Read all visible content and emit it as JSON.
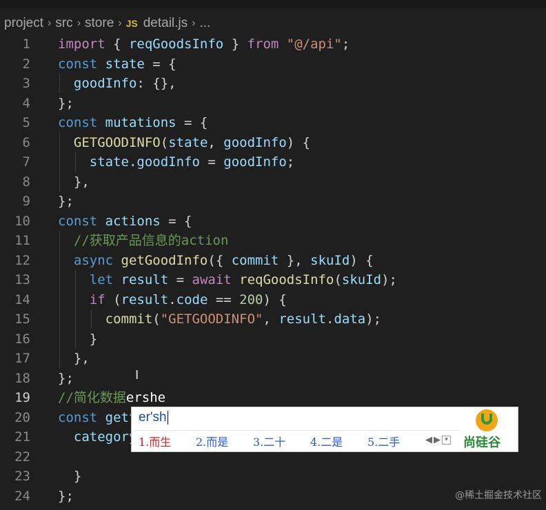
{
  "breadcrumb": {
    "items": [
      "project",
      "src",
      "store",
      "detail.js",
      "..."
    ],
    "file_badge": "JS"
  },
  "editor": {
    "active_line": 19,
    "lines": [
      {
        "n": "1",
        "tokens": [
          {
            "t": "import",
            "c": "kw2"
          },
          {
            "t": " { ",
            "c": "plain"
          },
          {
            "t": "reqGoodsInfo",
            "c": "var"
          },
          {
            "t": " } ",
            "c": "plain"
          },
          {
            "t": "from",
            "c": "kw2"
          },
          {
            "t": " ",
            "c": "plain"
          },
          {
            "t": "\"@/api\"",
            "c": "str"
          },
          {
            "t": ";",
            "c": "plain"
          }
        ]
      },
      {
        "n": "2",
        "tokens": [
          {
            "t": "const",
            "c": "kw"
          },
          {
            "t": " ",
            "c": "plain"
          },
          {
            "t": "state",
            "c": "var"
          },
          {
            "t": " = {",
            "c": "plain"
          }
        ]
      },
      {
        "n": "3",
        "tokens": [
          {
            "t": "  goodInfo",
            "c": "var"
          },
          {
            "t": ": {},",
            "c": "plain"
          }
        ]
      },
      {
        "n": "4",
        "tokens": [
          {
            "t": "};",
            "c": "plain"
          }
        ]
      },
      {
        "n": "5",
        "tokens": [
          {
            "t": "const",
            "c": "kw"
          },
          {
            "t": " ",
            "c": "plain"
          },
          {
            "t": "mutations",
            "c": "var"
          },
          {
            "t": " = {",
            "c": "plain"
          }
        ]
      },
      {
        "n": "6",
        "tokens": [
          {
            "t": "  ",
            "c": "plain"
          },
          {
            "t": "GETGOODINFO",
            "c": "fn"
          },
          {
            "t": "(",
            "c": "plain"
          },
          {
            "t": "state",
            "c": "var"
          },
          {
            "t": ", ",
            "c": "plain"
          },
          {
            "t": "goodInfo",
            "c": "var"
          },
          {
            "t": ") {",
            "c": "plain"
          }
        ]
      },
      {
        "n": "7",
        "tokens": [
          {
            "t": "    state",
            "c": "var"
          },
          {
            "t": ".",
            "c": "plain"
          },
          {
            "t": "goodInfo",
            "c": "var"
          },
          {
            "t": " = ",
            "c": "plain"
          },
          {
            "t": "goodInfo",
            "c": "var"
          },
          {
            "t": ";",
            "c": "plain"
          }
        ]
      },
      {
        "n": "8",
        "tokens": [
          {
            "t": "  },",
            "c": "plain"
          }
        ]
      },
      {
        "n": "9",
        "tokens": [
          {
            "t": "};",
            "c": "plain"
          }
        ]
      },
      {
        "n": "10",
        "tokens": [
          {
            "t": "const",
            "c": "kw"
          },
          {
            "t": " ",
            "c": "plain"
          },
          {
            "t": "actions",
            "c": "var"
          },
          {
            "t": " = {",
            "c": "plain"
          }
        ]
      },
      {
        "n": "11",
        "tokens": [
          {
            "t": "  //获取产品信息的action",
            "c": "cm"
          }
        ]
      },
      {
        "n": "12",
        "tokens": [
          {
            "t": "  ",
            "c": "plain"
          },
          {
            "t": "async",
            "c": "kw"
          },
          {
            "t": " ",
            "c": "plain"
          },
          {
            "t": "getGoodInfo",
            "c": "fn"
          },
          {
            "t": "({ ",
            "c": "plain"
          },
          {
            "t": "commit",
            "c": "var"
          },
          {
            "t": " }, ",
            "c": "plain"
          },
          {
            "t": "skuId",
            "c": "var"
          },
          {
            "t": ") {",
            "c": "plain"
          }
        ]
      },
      {
        "n": "13",
        "tokens": [
          {
            "t": "    ",
            "c": "plain"
          },
          {
            "t": "let",
            "c": "kw"
          },
          {
            "t": " ",
            "c": "plain"
          },
          {
            "t": "result",
            "c": "var"
          },
          {
            "t": " = ",
            "c": "plain"
          },
          {
            "t": "await",
            "c": "kw2"
          },
          {
            "t": " ",
            "c": "plain"
          },
          {
            "t": "reqGoodsInfo",
            "c": "fn"
          },
          {
            "t": "(",
            "c": "plain"
          },
          {
            "t": "skuId",
            "c": "var"
          },
          {
            "t": ");",
            "c": "plain"
          }
        ]
      },
      {
        "n": "14",
        "tokens": [
          {
            "t": "    ",
            "c": "plain"
          },
          {
            "t": "if",
            "c": "kw2"
          },
          {
            "t": " (",
            "c": "plain"
          },
          {
            "t": "result",
            "c": "var"
          },
          {
            "t": ".",
            "c": "plain"
          },
          {
            "t": "code",
            "c": "var"
          },
          {
            "t": " == ",
            "c": "plain"
          },
          {
            "t": "200",
            "c": "num"
          },
          {
            "t": ") {",
            "c": "plain"
          }
        ]
      },
      {
        "n": "15",
        "tokens": [
          {
            "t": "      ",
            "c": "plain"
          },
          {
            "t": "commit",
            "c": "fn"
          },
          {
            "t": "(",
            "c": "plain"
          },
          {
            "t": "\"GETGOODINFO\"",
            "c": "str"
          },
          {
            "t": ", ",
            "c": "plain"
          },
          {
            "t": "result",
            "c": "var"
          },
          {
            "t": ".",
            "c": "plain"
          },
          {
            "t": "data",
            "c": "var"
          },
          {
            "t": ");",
            "c": "plain"
          }
        ]
      },
      {
        "n": "16",
        "tokens": [
          {
            "t": "    }",
            "c": "plain"
          }
        ]
      },
      {
        "n": "17",
        "tokens": [
          {
            "t": "  },",
            "c": "plain"
          }
        ]
      },
      {
        "n": "18",
        "tokens": [
          {
            "t": "};",
            "c": "plain"
          }
        ]
      },
      {
        "n": "19",
        "tokens": [
          {
            "t": "//简化数据",
            "c": "cm"
          },
          {
            "t": "ershe",
            "c": "white"
          }
        ]
      },
      {
        "n": "20",
        "tokens": [
          {
            "t": "const",
            "c": "kw"
          },
          {
            "t": " ",
            "c": "plain"
          },
          {
            "t": "gett",
            "c": "var"
          }
        ]
      },
      {
        "n": "21",
        "tokens": [
          {
            "t": "  ",
            "c": "plain"
          },
          {
            "t": "category",
            "c": "var"
          }
        ]
      },
      {
        "n": "22",
        "tokens": []
      },
      {
        "n": "23",
        "tokens": [
          {
            "t": "  }",
            "c": "plain"
          }
        ]
      },
      {
        "n": "24",
        "tokens": [
          {
            "t": "};",
            "c": "plain"
          }
        ]
      }
    ]
  },
  "ime": {
    "input": "er'sh",
    "candidates": [
      "1.而生",
      "2.而是",
      "3.二十",
      "4.二是",
      "5.二手"
    ],
    "logo_text": "尚硅谷"
  },
  "watermark": "@稀土掘金技术社区",
  "colors": {
    "background": "#1f1f1f",
    "keyword": "#569cd6",
    "control_keyword": "#c586c0",
    "function": "#dcdcaa",
    "variable": "#9cdcfe",
    "string": "#ce9178",
    "number": "#b5cea8",
    "comment": "#6a9955"
  }
}
